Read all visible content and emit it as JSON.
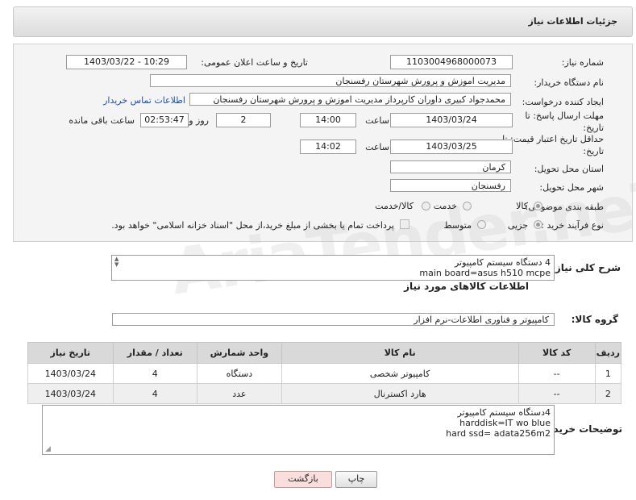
{
  "header": {
    "title": "جزئیات اطلاعات نیاز"
  },
  "fields": {
    "need_number_label": "شماره نیاز:",
    "need_number": "1103004968000073",
    "announce_label": "تاریخ و ساعت اعلان عمومی:",
    "announce_value": "1403/03/22 - 10:29",
    "buyer_label": "نام دستگاه خریدار:",
    "buyer_value": "مدیریت اموزش و پرورش شهرستان رفسنجان",
    "creator_label": "ایجاد کننده درخواست:",
    "creator_value": "محمدجواد کبیری داوران کارپرداز مدیریت اموزش و پرورش شهرستان رفسنجان",
    "contact_link": "اطلاعات تماس خریدار",
    "deadline_label": "مهلت ارسال پاسخ: تا تاریخ:",
    "deadline_date": "1403/03/24",
    "deadline_time_label": "ساعت",
    "deadline_time": "14:00",
    "days_value": "2",
    "days_label": "روز و",
    "remaining_time": "02:53:47",
    "remaining_label": "ساعت باقی مانده",
    "validity_label": "حداقل تاریخ اعتبار قیمت: تا تاریخ:",
    "validity_date": "1403/03/25",
    "validity_time_label": "ساعت",
    "validity_time": "14:02",
    "province_label": "استان محل تحویل:",
    "province_value": "کرمان",
    "city_label": "شهر محل تحویل:",
    "city_value": "رفسنجان",
    "category_label": "طبقه بندی موضوعی:",
    "category_options": [
      "کالا",
      "خدمت",
      "کالا/خدمت"
    ],
    "process_label": "نوع فرآیند خرید :",
    "process_options": [
      "جزیی",
      "متوسط"
    ],
    "payment_note": "پرداخت تمام یا بخشی از مبلغ خرید،از محل \"اسناد خزانه اسلامی\" خواهد بود."
  },
  "summary": {
    "label": "شرح کلی نیاز:",
    "line1": "4 دستگاه سیستم کامپیوتر",
    "line2": "main board=asus h510 mcpe"
  },
  "goods_info_title": "اطلاعات کالاهای مورد نیاز",
  "goods_group": {
    "label": "گروه کالا:",
    "value": "کامپیوتر و فناوری اطلاعات-نرم افزار"
  },
  "table": {
    "headers": [
      "ردیف",
      "کد کالا",
      "نام کالا",
      "واحد شمارش",
      "تعداد / مقدار",
      "تاریخ نیاز"
    ],
    "rows": [
      [
        "1",
        "--",
        "کامپیوتر شخصی",
        "دستگاه",
        "4",
        "1403/03/24"
      ],
      [
        "2",
        "--",
        "هارد اکسترنال",
        "عدد",
        "4",
        "1403/03/24"
      ]
    ]
  },
  "buyer_notes": {
    "label": "توضیحات خریدار:",
    "line1": "4دستگاه سیستم کامپیوتر",
    "line2": "harddisk=IT wo blue",
    "line3": "hard ssd= adata256m2"
  },
  "buttons": {
    "print": "چاپ",
    "back": "بازگشت"
  },
  "watermark": "AriaTender.neT",
  "colors": {
    "link": "#1a4fb0",
    "table_header": "#d9d9d9",
    "back_button": "#f9dede"
  }
}
